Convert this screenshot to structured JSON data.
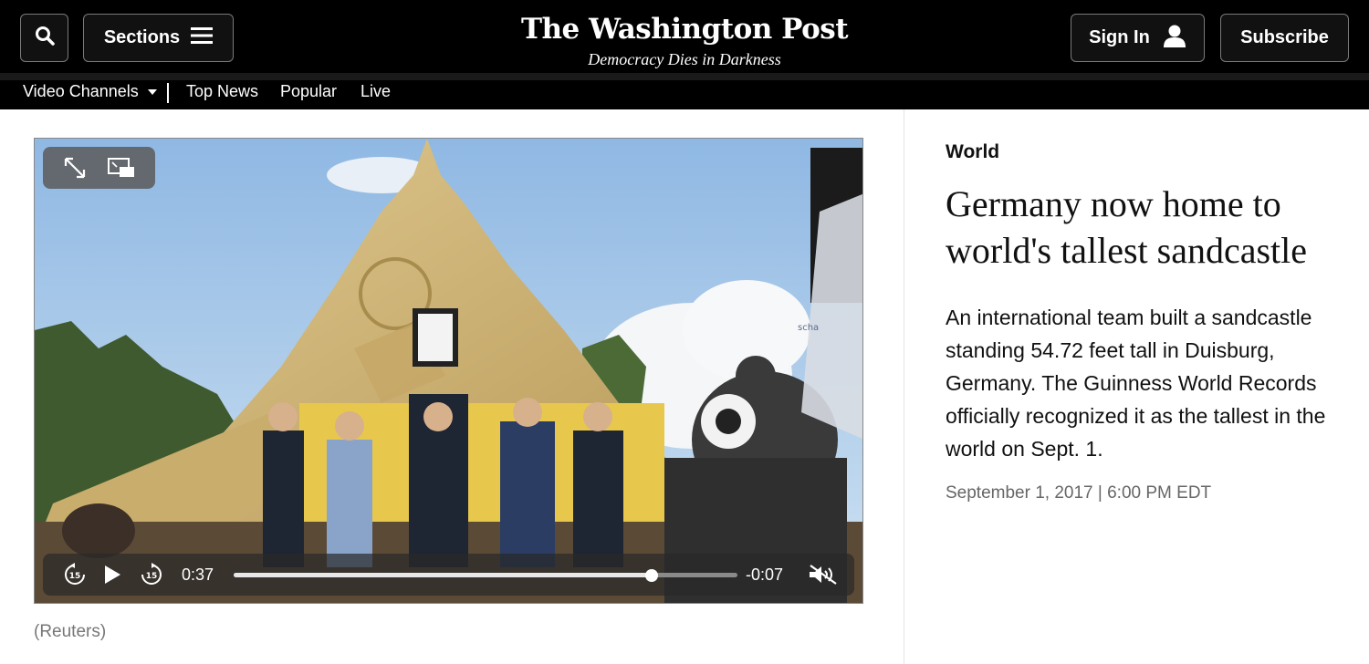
{
  "header": {
    "search_icon": "search-icon",
    "sections_label": "Sections",
    "logo_text": "The Washington Post",
    "tagline": "Democracy Dies in Darkness",
    "signin_label": "Sign In",
    "subscribe_label": "Subscribe"
  },
  "subnav": {
    "items": [
      {
        "label": "Video Channels"
      },
      {
        "label": "Top News"
      },
      {
        "label": "Popular"
      },
      {
        "label": "Live"
      }
    ]
  },
  "video": {
    "elapsed": "0:37",
    "remaining": "-0:07",
    "progress": 0.83,
    "skip_back_label": "15",
    "skip_forward_label": "15",
    "state": "paused",
    "muted": true,
    "sign_text": "scha",
    "credit": "(Reuters)"
  },
  "article": {
    "kicker": "World",
    "headline": "Germany now home to world's tallest sandcastle",
    "blurb": "An international team built a sandcastle standing 54.72 feet tall in Duisburg, Germany. The Guinness World Records officially recognized it as the tallest in the world on Sept. 1.",
    "dateline": "September 1, 2017 | 6:00 PM EDT"
  },
  "colors": {
    "header_bg": "#000000",
    "sky": "#a9c9e8",
    "sand": "#d2b97e",
    "text": "#111111",
    "muted": "#666666"
  }
}
